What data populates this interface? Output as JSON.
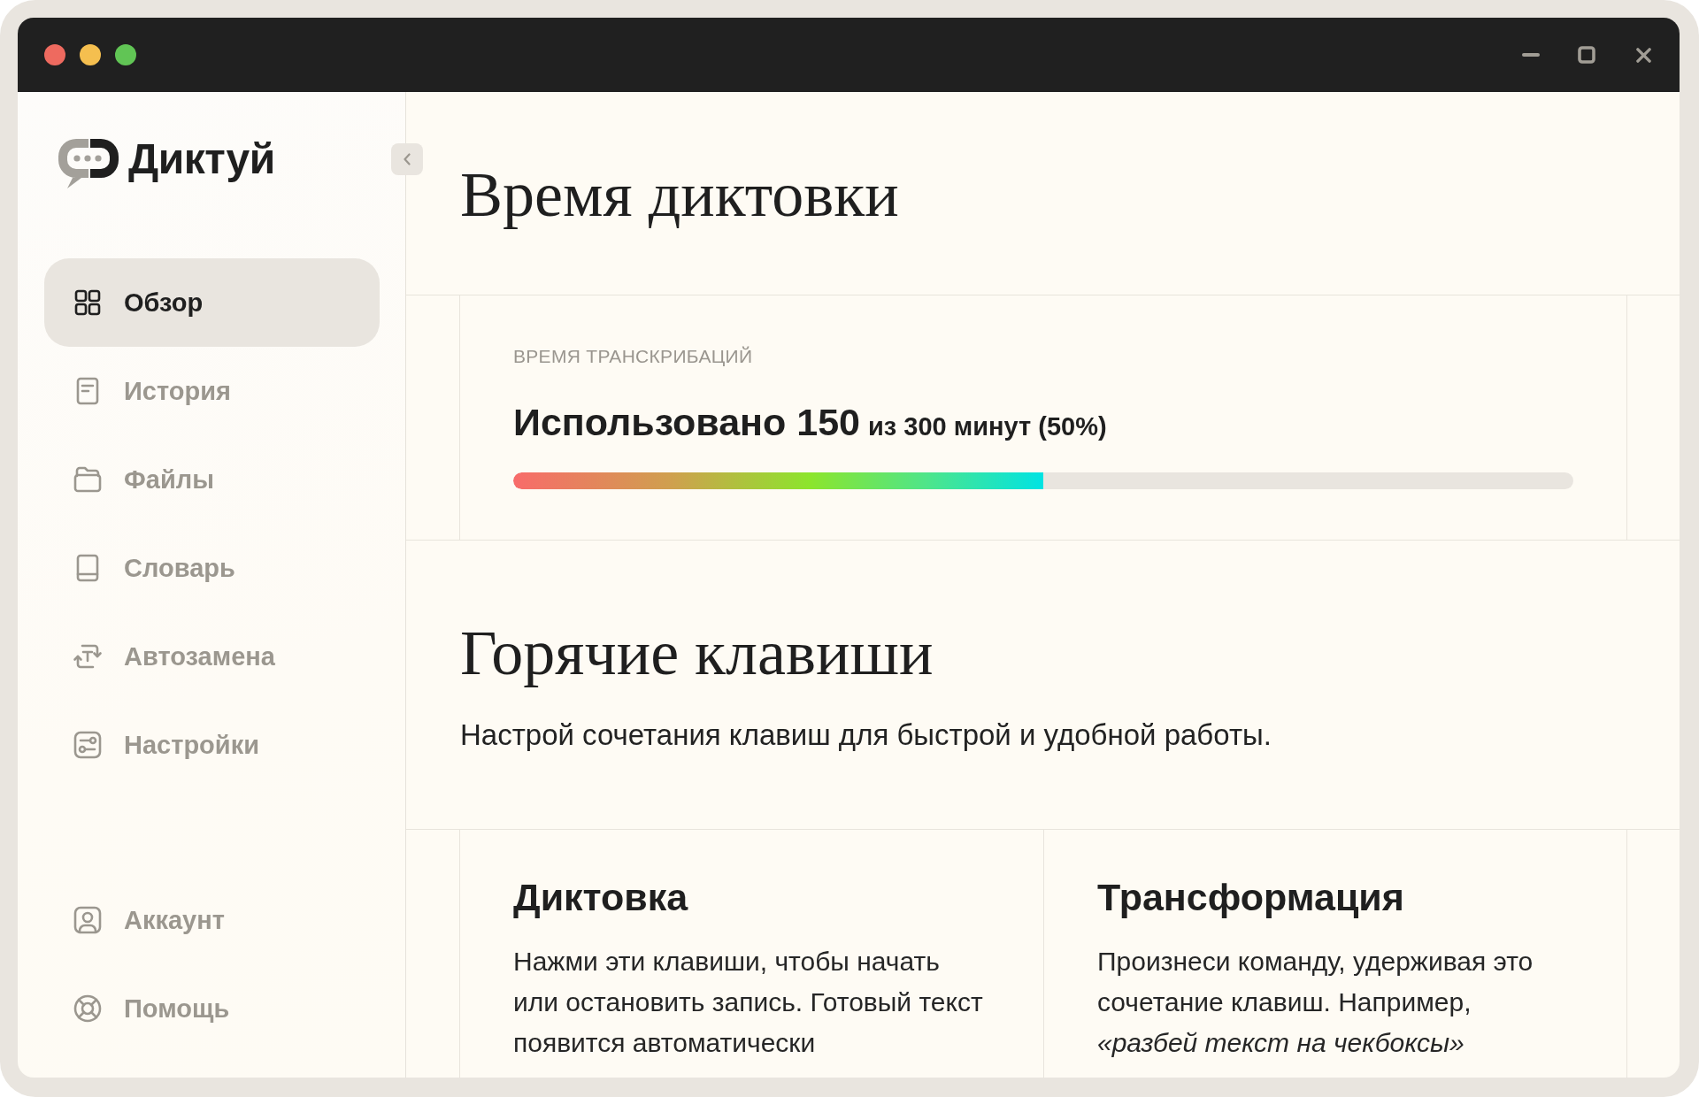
{
  "app": {
    "name": "Диктуй"
  },
  "sidebar": {
    "items": [
      {
        "label": "Обзор",
        "selected": true
      },
      {
        "label": "История",
        "selected": false
      },
      {
        "label": "Файлы",
        "selected": false
      },
      {
        "label": "Словарь",
        "selected": false
      },
      {
        "label": "Автозамена",
        "selected": false
      },
      {
        "label": "Настройки",
        "selected": false
      }
    ],
    "footer_items": [
      {
        "label": "Аккаунт",
        "selected": false
      },
      {
        "label": "Помощь",
        "selected": false
      }
    ]
  },
  "page": {
    "title": "Время диктовки"
  },
  "usage": {
    "label": "ВРЕМЯ ТРАНСКРИБАЦИЙ",
    "used": "Использовано 150",
    "total": "из 300 минут (50%)",
    "level": 0.5
  },
  "hotkeys": {
    "title": "Горячие клавиши",
    "subtitle": "Настрой сочетания клавиш для быстрой и удобной работы.",
    "cards": [
      {
        "title": "Диктовка",
        "text": "Нажми эти клавиши, чтобы начать или остановить запись. Готовый текст появится автоматически"
      },
      {
        "title": "Трансформация",
        "text": "Произнеси команду, удерживая это сочетание клавиш. Например, *«разбей текст на чекбоксы»*"
      }
    ]
  }
}
